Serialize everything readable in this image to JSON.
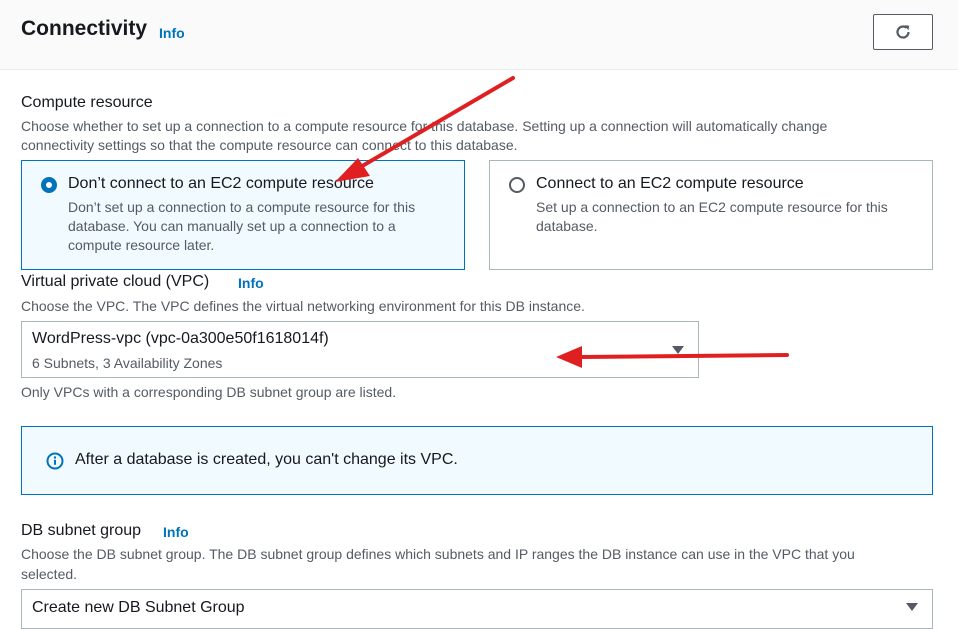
{
  "header": {
    "title": "Connectivity",
    "info": "Info",
    "refresh_icon": "refresh-icon"
  },
  "compute": {
    "label": "Compute resource",
    "desc1": "Choose whether to set up a connection to a compute resource for this database. Setting up a connection will automatically change",
    "desc2": "connectivity settings so that the compute resource can connect to this database.",
    "options": [
      {
        "title": "Don’t connect to an EC2 compute resource",
        "desc": [
          "Don’t set up a connection to a compute resource for this",
          "database. You can manually set up a connection to a",
          "compute resource later."
        ],
        "selected": true
      },
      {
        "title": "Connect to an EC2 compute resource",
        "desc": [
          "Set up a connection to an EC2 compute resource for this",
          "database."
        ],
        "selected": false
      }
    ]
  },
  "vpc": {
    "label": "Virtual private cloud (VPC)",
    "info": "Info",
    "desc": "Choose the VPC. The VPC defines the virtual networking environment for this DB instance.",
    "selected_value": "WordPress-vpc (vpc-0a300e50f1618014f)",
    "selected_sub": "6 Subnets, 3 Availability Zones",
    "hint": "Only VPCs with a corresponding DB subnet group are listed."
  },
  "alert": {
    "text": "After a database is created, you can't change its VPC.",
    "icon": "info-circle-icon"
  },
  "subnet": {
    "label": "DB subnet group",
    "info": "Info",
    "desc1": "Choose the DB subnet group. The DB subnet group defines which subnets and IP ranges the DB instance can use in the VPC that you",
    "desc2": "selected.",
    "selected_value": "Create new DB Subnet Group"
  },
  "colors": {
    "accent": "#0073bb",
    "annotation_arrow": "#e02020"
  }
}
